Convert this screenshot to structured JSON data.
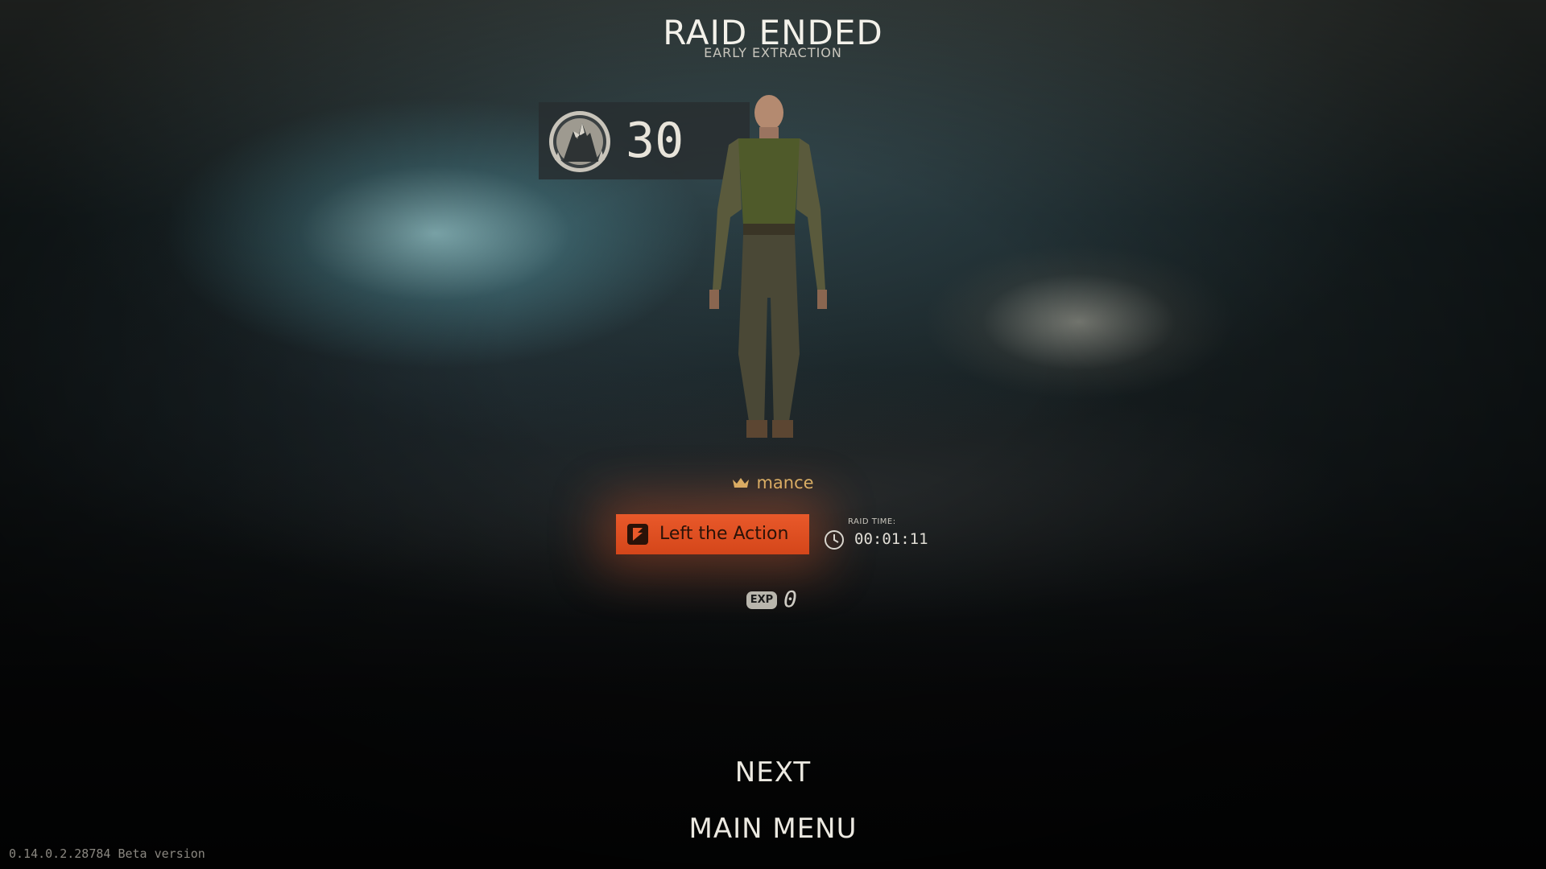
{
  "header": {
    "title": "RAID ENDED",
    "subtitle": "EARLY EXTRACTION"
  },
  "player": {
    "level": "30",
    "name": "mance",
    "name_color": "#d9b56a"
  },
  "result": {
    "status_label": "Left the Action",
    "status_color": "#e4521f",
    "raid_time_label": "RAID TIME:",
    "raid_time_value": "00:01:11"
  },
  "experience": {
    "badge": "EXP",
    "value": "0"
  },
  "menu": {
    "next_label": "NEXT",
    "main_menu_label": "MAIN MENU"
  },
  "footer": {
    "version": "0.14.0.2.28784 Beta version"
  },
  "icons": {
    "level_emblem": "mountain-emblem-icon",
    "crown": "crown-icon",
    "status": "left-action-icon",
    "clock": "clock-icon"
  }
}
